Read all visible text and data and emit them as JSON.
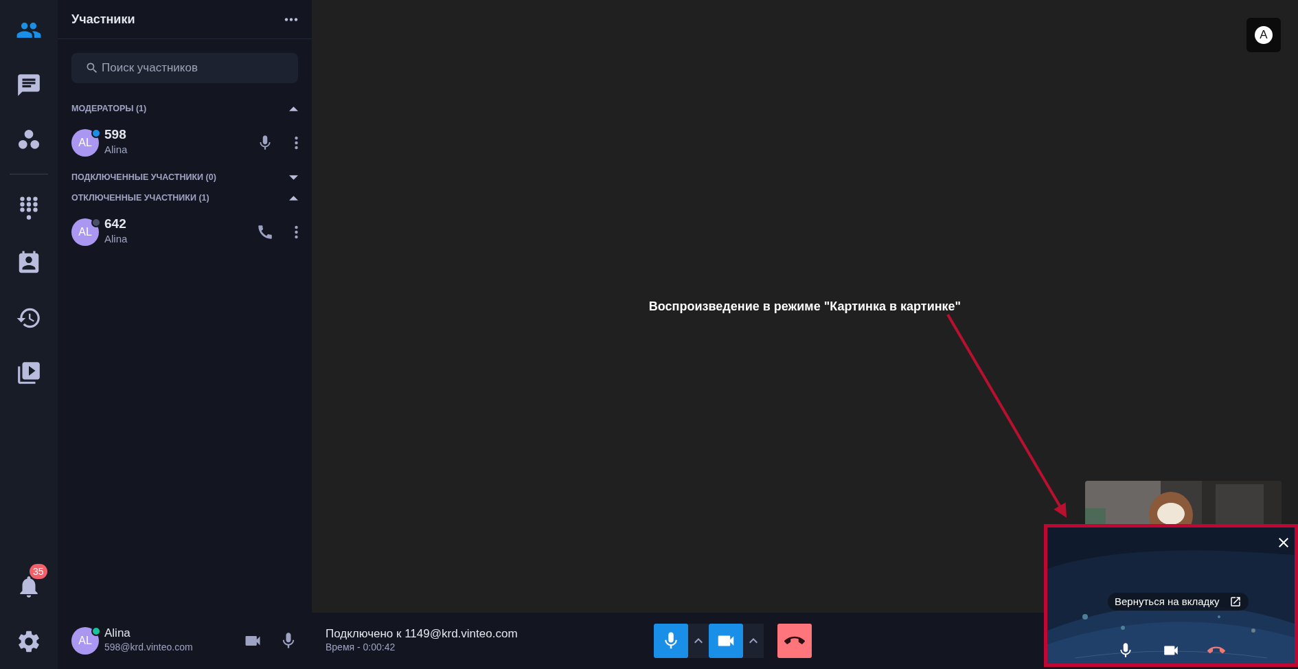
{
  "rail": {
    "items": [
      {
        "kind": "participants",
        "selected": true
      },
      {
        "kind": "chat",
        "selected": false
      },
      {
        "kind": "groups",
        "selected": false
      },
      {
        "kind": "dialpad",
        "selected": false
      },
      {
        "kind": "contacts",
        "selected": false
      },
      {
        "kind": "history",
        "selected": false
      },
      {
        "kind": "recordings",
        "selected": false
      }
    ],
    "notifications": {
      "count": "35"
    }
  },
  "panel": {
    "title": "Участники",
    "search": {
      "placeholder": "Поиск участников"
    },
    "groups": [
      {
        "title": "МОДЕРАТОРЫ (1)",
        "expanded": true,
        "members": [
          {
            "number": "598",
            "name": "Alina",
            "initials": "AL",
            "color": "#1a8fe8",
            "kind": "mic"
          }
        ]
      },
      {
        "title": "ПОДКЛЮЧЕННЫЕ УЧАСТНИКИ (0)",
        "expanded": false
      },
      {
        "title": "ОТКЛЮЧЕННЫЕ УЧАСТНИКИ (1)",
        "expanded": true,
        "members": [
          {
            "number": "642",
            "name": "Alina",
            "initials": "AL",
            "color": "#4a5068",
            "kind": "phone"
          }
        ]
      }
    ]
  },
  "account": {
    "initial": "A"
  },
  "annotation": {
    "text": "Воспроизведение в режиме \"Картинка в картинке\""
  },
  "bottom_bar": {
    "user": {
      "name": "Alina",
      "email": "598@krd.vinteo.com",
      "initials": "AL",
      "color": "#17c39a"
    },
    "connection": {
      "status": "Подключено к 1149@krd.vinteo.com",
      "time": "Время - 0:00:42"
    },
    "microphone": {
      "on": true
    },
    "camera": {
      "on": true
    }
  },
  "pip": {
    "return_button": "Вернуться на вкладку",
    "microphone": {
      "on": true
    },
    "camera": {
      "on": true
    }
  }
}
